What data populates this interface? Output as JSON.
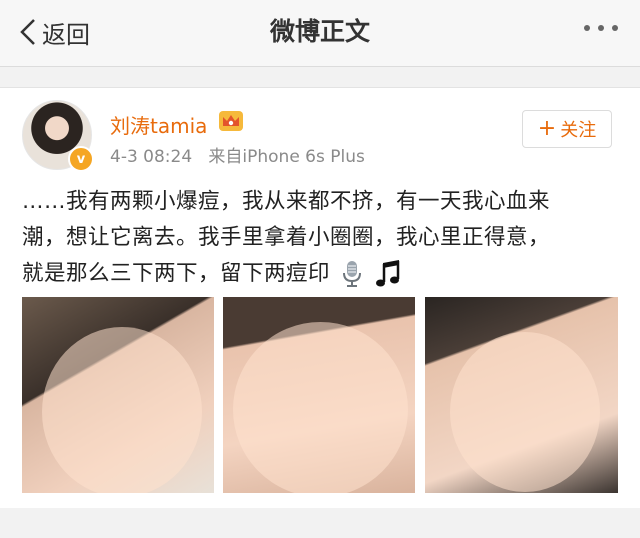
{
  "nav": {
    "back_label": "返回",
    "title": "微博正文"
  },
  "post": {
    "user_name": "刘涛tamia",
    "time": "4-3 08:24",
    "source": "来自iPhone 6s Plus",
    "follow_label": "关注",
    "text_lines": [
      "……我有两颗小爆痘，我从来都不挤，有一天我心血来",
      "潮，想让它离去。我手里拿着小圈圈，我心里正得意，",
      "就是那么三下两下，留下两痘印"
    ]
  },
  "photos": [
    "selfie-photo-1",
    "selfie-photo-2",
    "selfie-photo-3"
  ],
  "colors": {
    "accent_orange": "#e86b0c",
    "badge_gold": "#f5a623",
    "background": "#f2f2f2"
  }
}
